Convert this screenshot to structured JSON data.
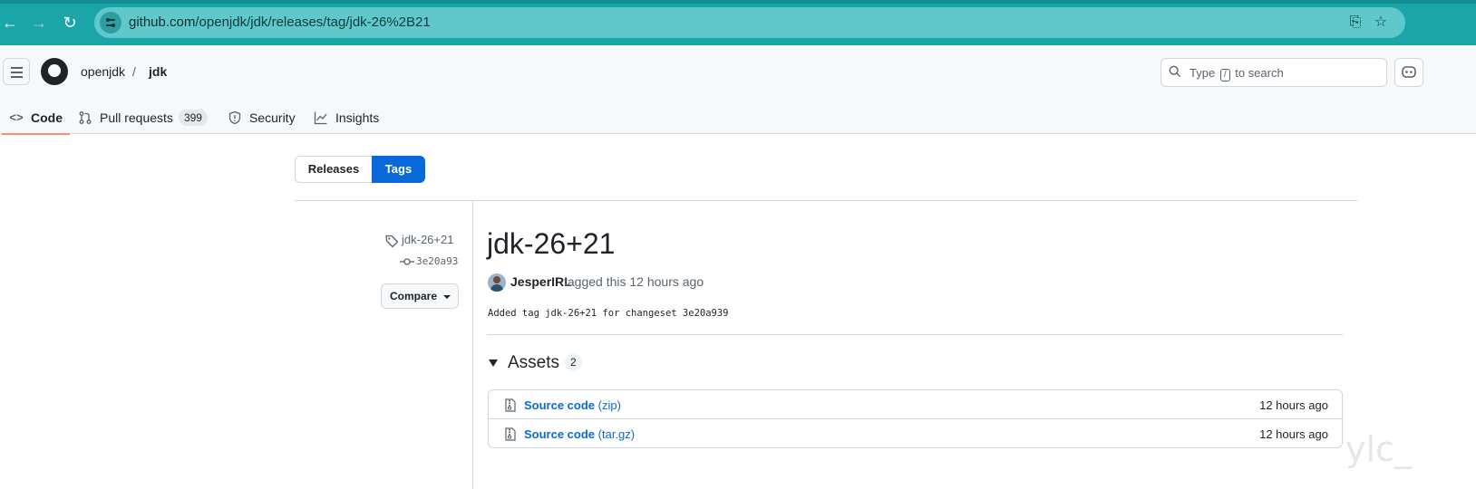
{
  "browser": {
    "url_host": "github.com",
    "url_path": "/openjdk/jdk/releases/tag/jdk-26%2B21"
  },
  "header": {
    "owner": "openjdk",
    "separator": "/",
    "repo": "jdk",
    "search_prefix": "Type",
    "search_key": "/",
    "search_suffix": "to search"
  },
  "tabs": [
    {
      "label": "Code",
      "icon": "code-icon",
      "selected": true
    },
    {
      "label": "Pull requests",
      "icon": "pull-request-icon",
      "count": "399"
    },
    {
      "label": "Security",
      "icon": "shield-icon"
    },
    {
      "label": "Insights",
      "icon": "graph-icon"
    }
  ],
  "toggle": {
    "releases": "Releases",
    "tags": "Tags",
    "active": "Tags"
  },
  "sidebar": {
    "tag": "jdk-26+21",
    "commit": "3e20a93",
    "compare": "Compare"
  },
  "release": {
    "title": "jdk-26+21",
    "author": "JesperIRL",
    "author_action": "tagged this 12 hours ago",
    "message": "Added tag jdk-26+21 for changeset 3e20a939"
  },
  "assets": {
    "title": "Assets",
    "count": "2",
    "items": [
      {
        "name": "Source code",
        "ext": "(zip)",
        "time": "12 hours ago"
      },
      {
        "name": "Source code",
        "ext": "(tar.gz)",
        "time": "12 hours ago"
      }
    ]
  },
  "watermark": "ylc_",
  "colors": {
    "browser_accent": "#1aa6a8",
    "link": "#0969da",
    "selected_tab_underline": "#fd8c73"
  }
}
